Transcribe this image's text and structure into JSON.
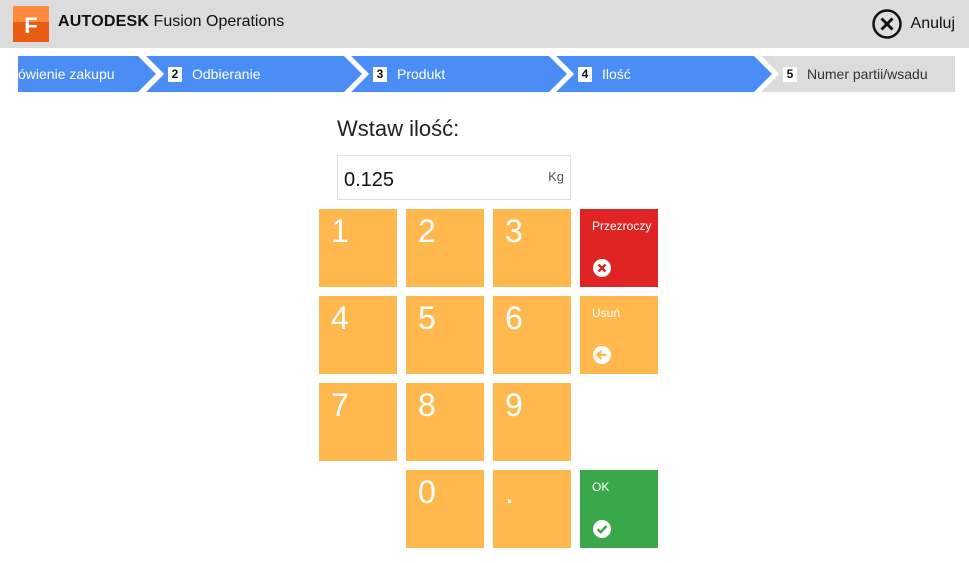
{
  "header": {
    "brand_bold": "AUTODESK",
    "brand_rest": " Fusion Operations",
    "logo_letter": "F",
    "cancel_label": "Anuluj"
  },
  "steps": [
    {
      "number": "",
      "label": "ówienie zakupu",
      "state": "active"
    },
    {
      "number": "2",
      "label": "Odbieranie",
      "state": "active"
    },
    {
      "number": "3",
      "label": "Produkt",
      "state": "active"
    },
    {
      "number": "4",
      "label": "Ilość",
      "state": "active"
    },
    {
      "number": "5",
      "label": "Numer partii/wsadu",
      "state": "inactive"
    }
  ],
  "quantity": {
    "label": "Wstaw ilość:",
    "value": "0.125",
    "unit": "Kg"
  },
  "keypad": {
    "k1": "1",
    "k2": "2",
    "k3": "3",
    "k4": "4",
    "k5": "5",
    "k6": "6",
    "k7": "7",
    "k8": "8",
    "k9": "9",
    "k0": "0",
    "kdot": "."
  },
  "actions": {
    "clear_label": "Przezroczy",
    "delete_label": "Usuń",
    "ok_label": "OK"
  },
  "colors": {
    "step_active": "#4a8ef5",
    "step_inactive": "#dcdcdc",
    "key": "#ffb84d",
    "clear": "#e02424",
    "ok": "#3aa84a",
    "logo": "#f26a1b"
  }
}
